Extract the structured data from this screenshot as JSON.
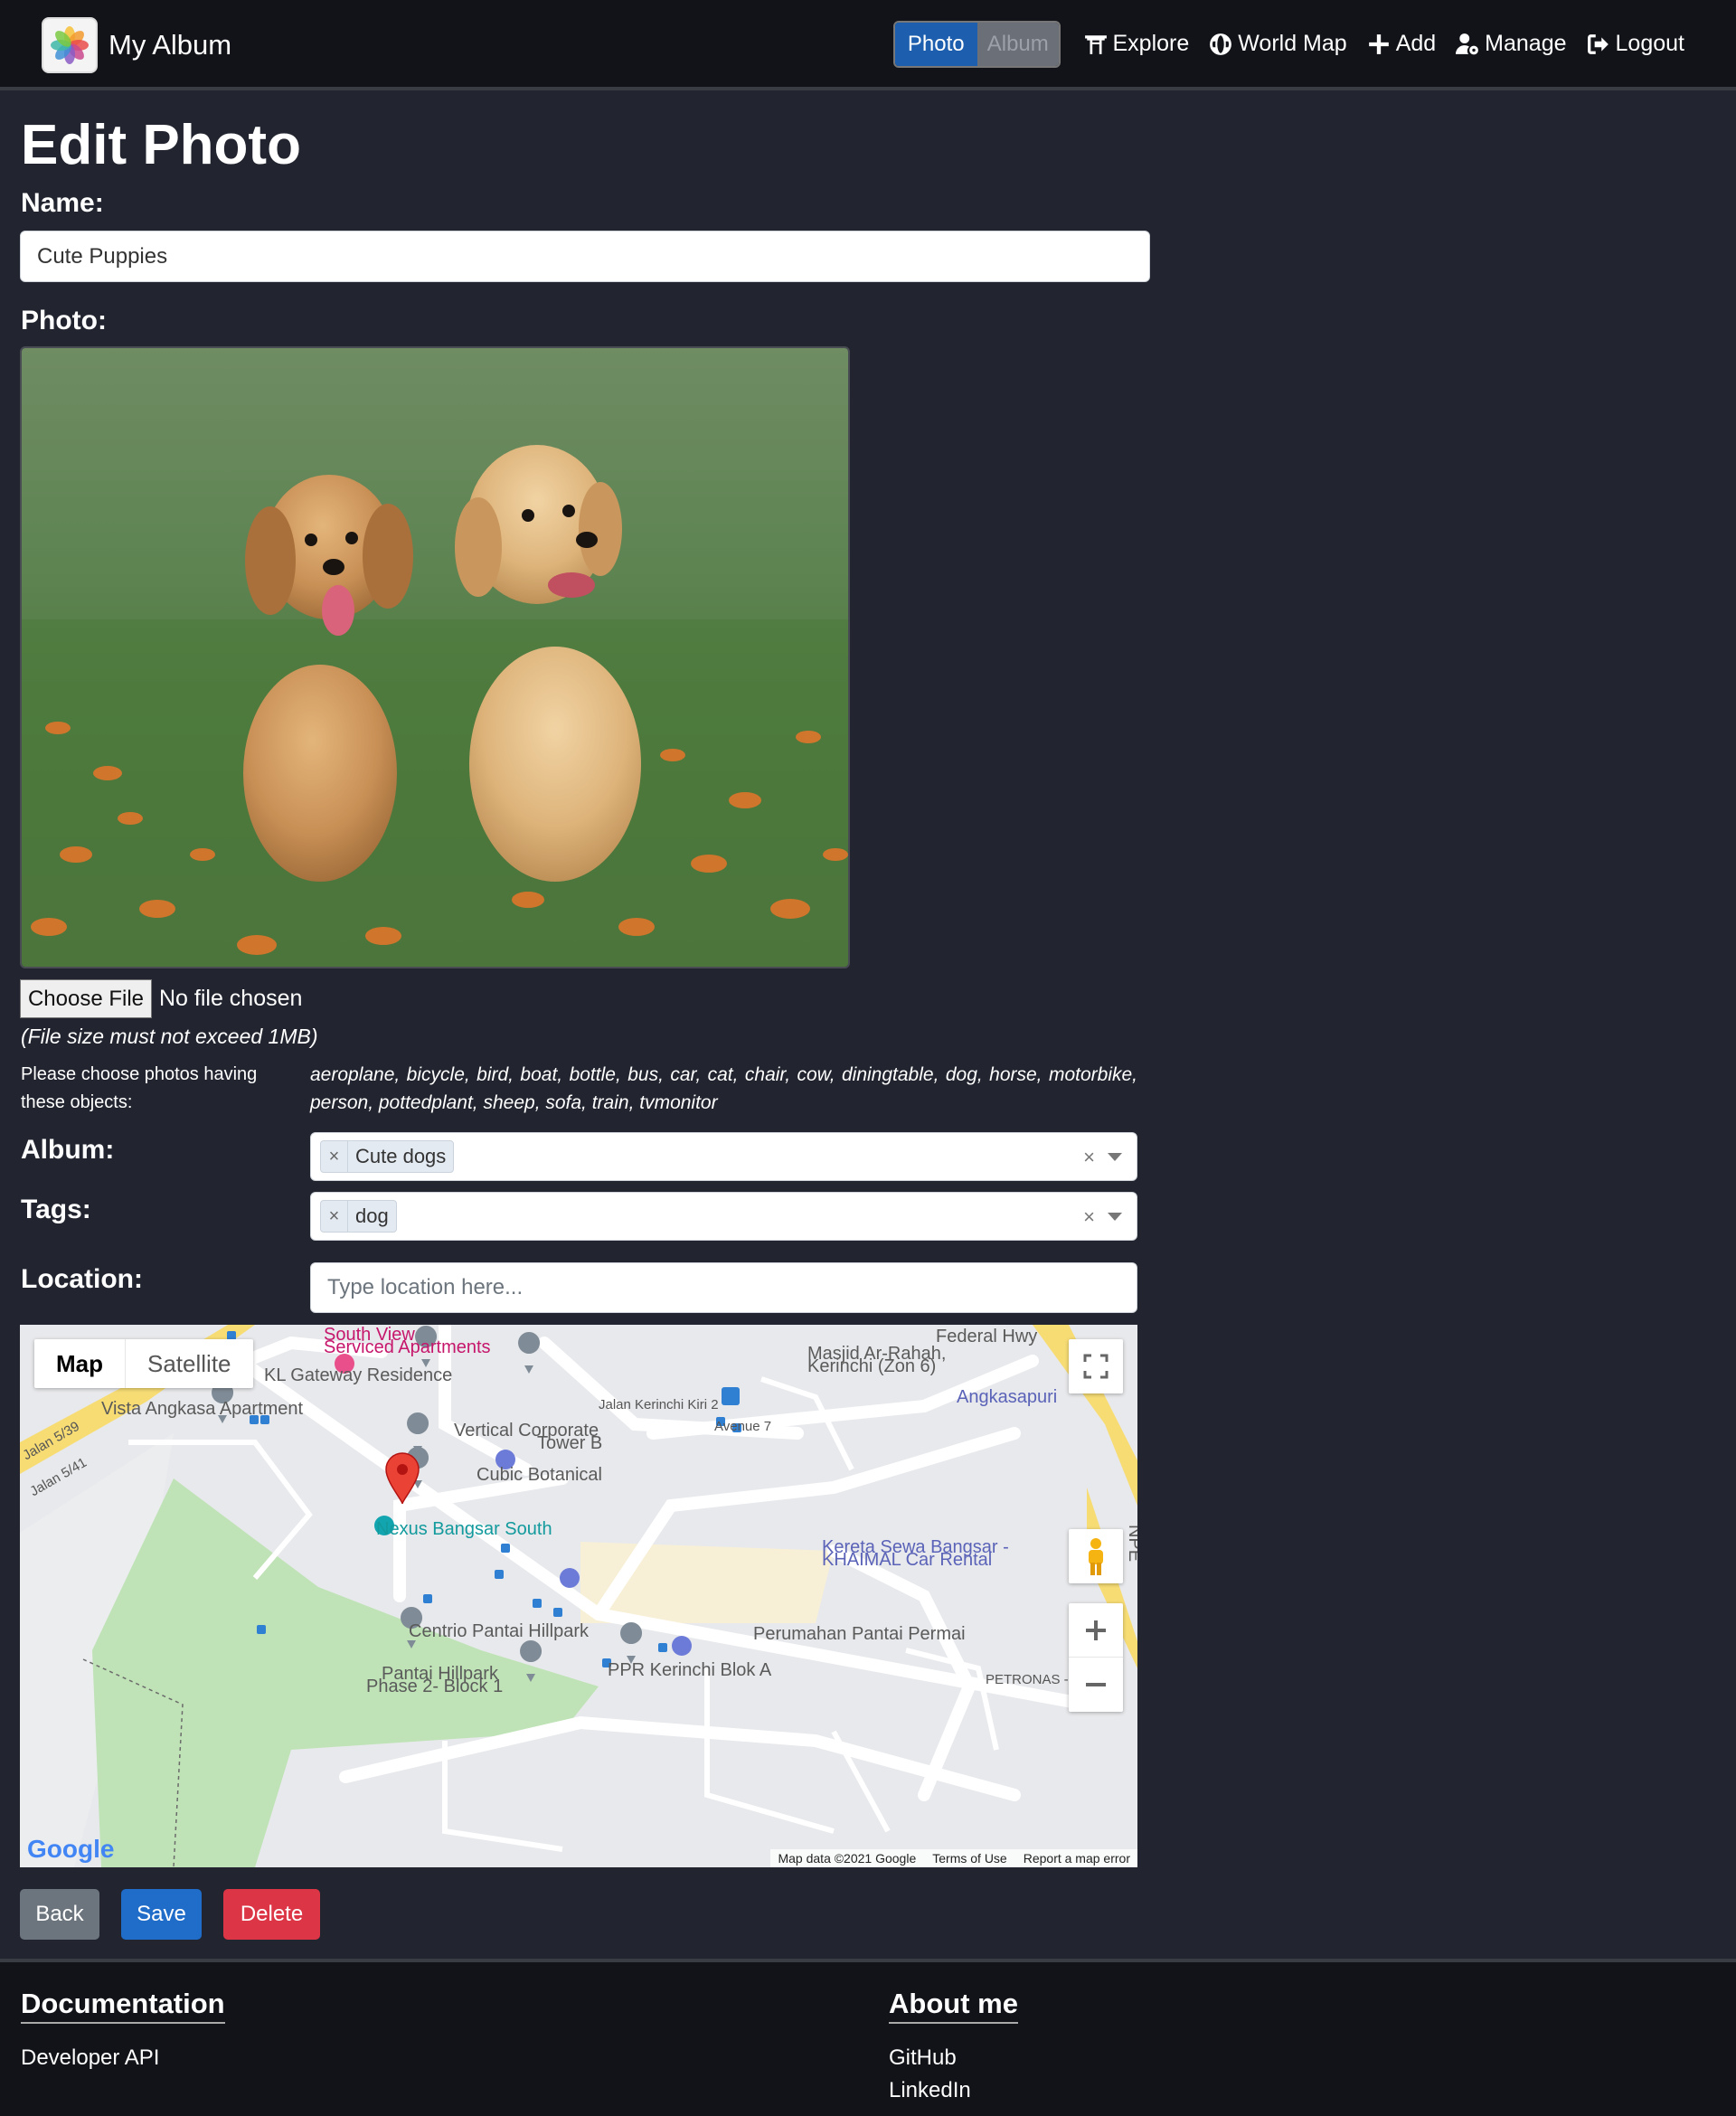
{
  "navbar": {
    "brand": "My Album",
    "toggle": {
      "photo": "Photo",
      "album": "Album"
    },
    "links": [
      {
        "label": "Explore",
        "icon": "torii-gate-icon"
      },
      {
        "label": "World Map",
        "icon": "globe-icon"
      },
      {
        "label": "Add",
        "icon": "plus-icon"
      },
      {
        "label": "Manage",
        "icon": "user-gear-icon"
      },
      {
        "label": "Logout",
        "icon": "logout-icon"
      }
    ]
  },
  "form": {
    "title": "Edit Photo",
    "name_label": "Name:",
    "name_value": "Cute Puppies",
    "photo_label": "Photo:",
    "choose_file": "Choose File",
    "file_status": "No file chosen",
    "size_hint": "(File size must not exceed 1MB)",
    "objects_prompt": "Please choose photos having these objects:",
    "objects_list": "aeroplane, bicycle, bird, boat, bottle, bus, car, cat, chair, cow, diningtable, dog, horse, motorbike, person, pottedplant, sheep, sofa, train, tvmonitor",
    "album_label": "Album:",
    "album_value": "Cute dogs",
    "tags_label": "Tags:",
    "tags_value": "dog",
    "location_label": "Location:",
    "location_placeholder": "Type location here..."
  },
  "map": {
    "type_map": "Map",
    "type_satellite": "Satellite",
    "labels": {
      "south_view": "South View",
      "serviced": "Serviced Apartments",
      "federal": "Federal Hwy",
      "masjid1": "Masjid Ar-Rahah,",
      "masjid2": "Kerinchi (Zon 6)",
      "kl_gateway": "KL Gateway Residence",
      "angkasapuri": "Angkasapuri",
      "vista": "Vista Angkasa Apartment",
      "jalan_kiri": "Jalan Kerinchi Kiri 2",
      "avenue7": "Avenue 7",
      "vertical1": "Vertical Corporate",
      "vertical2": "Tower B",
      "jalan539": "Jalan 5/39",
      "jalan541": "Jalan 5/41",
      "cubic": "Cubic Botanical",
      "nexus": "Nexus Bangsar South",
      "kereta1": "Kereta Sewa Bangsar -",
      "kereta2": "KHAIMAL Car Rental",
      "npe": "NPE",
      "centrio": "Centrio Pantai Hillpark",
      "perumahan": "Perumahan Pantai Permai",
      "pantai1": "Pantai Hillpark",
      "pantai2": "Phase 2- Block 1",
      "ppr": "PPR Kerinchi Blok A",
      "petronas": "PETRONAS - NPE",
      "road_number": "2"
    },
    "google": "Google",
    "attribution": [
      "Map data ©2021 Google",
      "Terms of Use",
      "Report a map error"
    ]
  },
  "buttons": {
    "back": "Back",
    "save": "Save",
    "delete": "Delete"
  },
  "footer": {
    "docs_title": "Documentation",
    "docs_links": [
      "Developer API"
    ],
    "about_title": "About me",
    "about_links": [
      "GitHub",
      "LinkedIn"
    ]
  },
  "colors": {
    "background": "#222530",
    "navbar": "#121318",
    "toggle_active": "#1d5fae",
    "save": "#1f6cc9",
    "delete": "#dc3545",
    "back": "#6c757d",
    "map_marker": "#ea4335"
  }
}
